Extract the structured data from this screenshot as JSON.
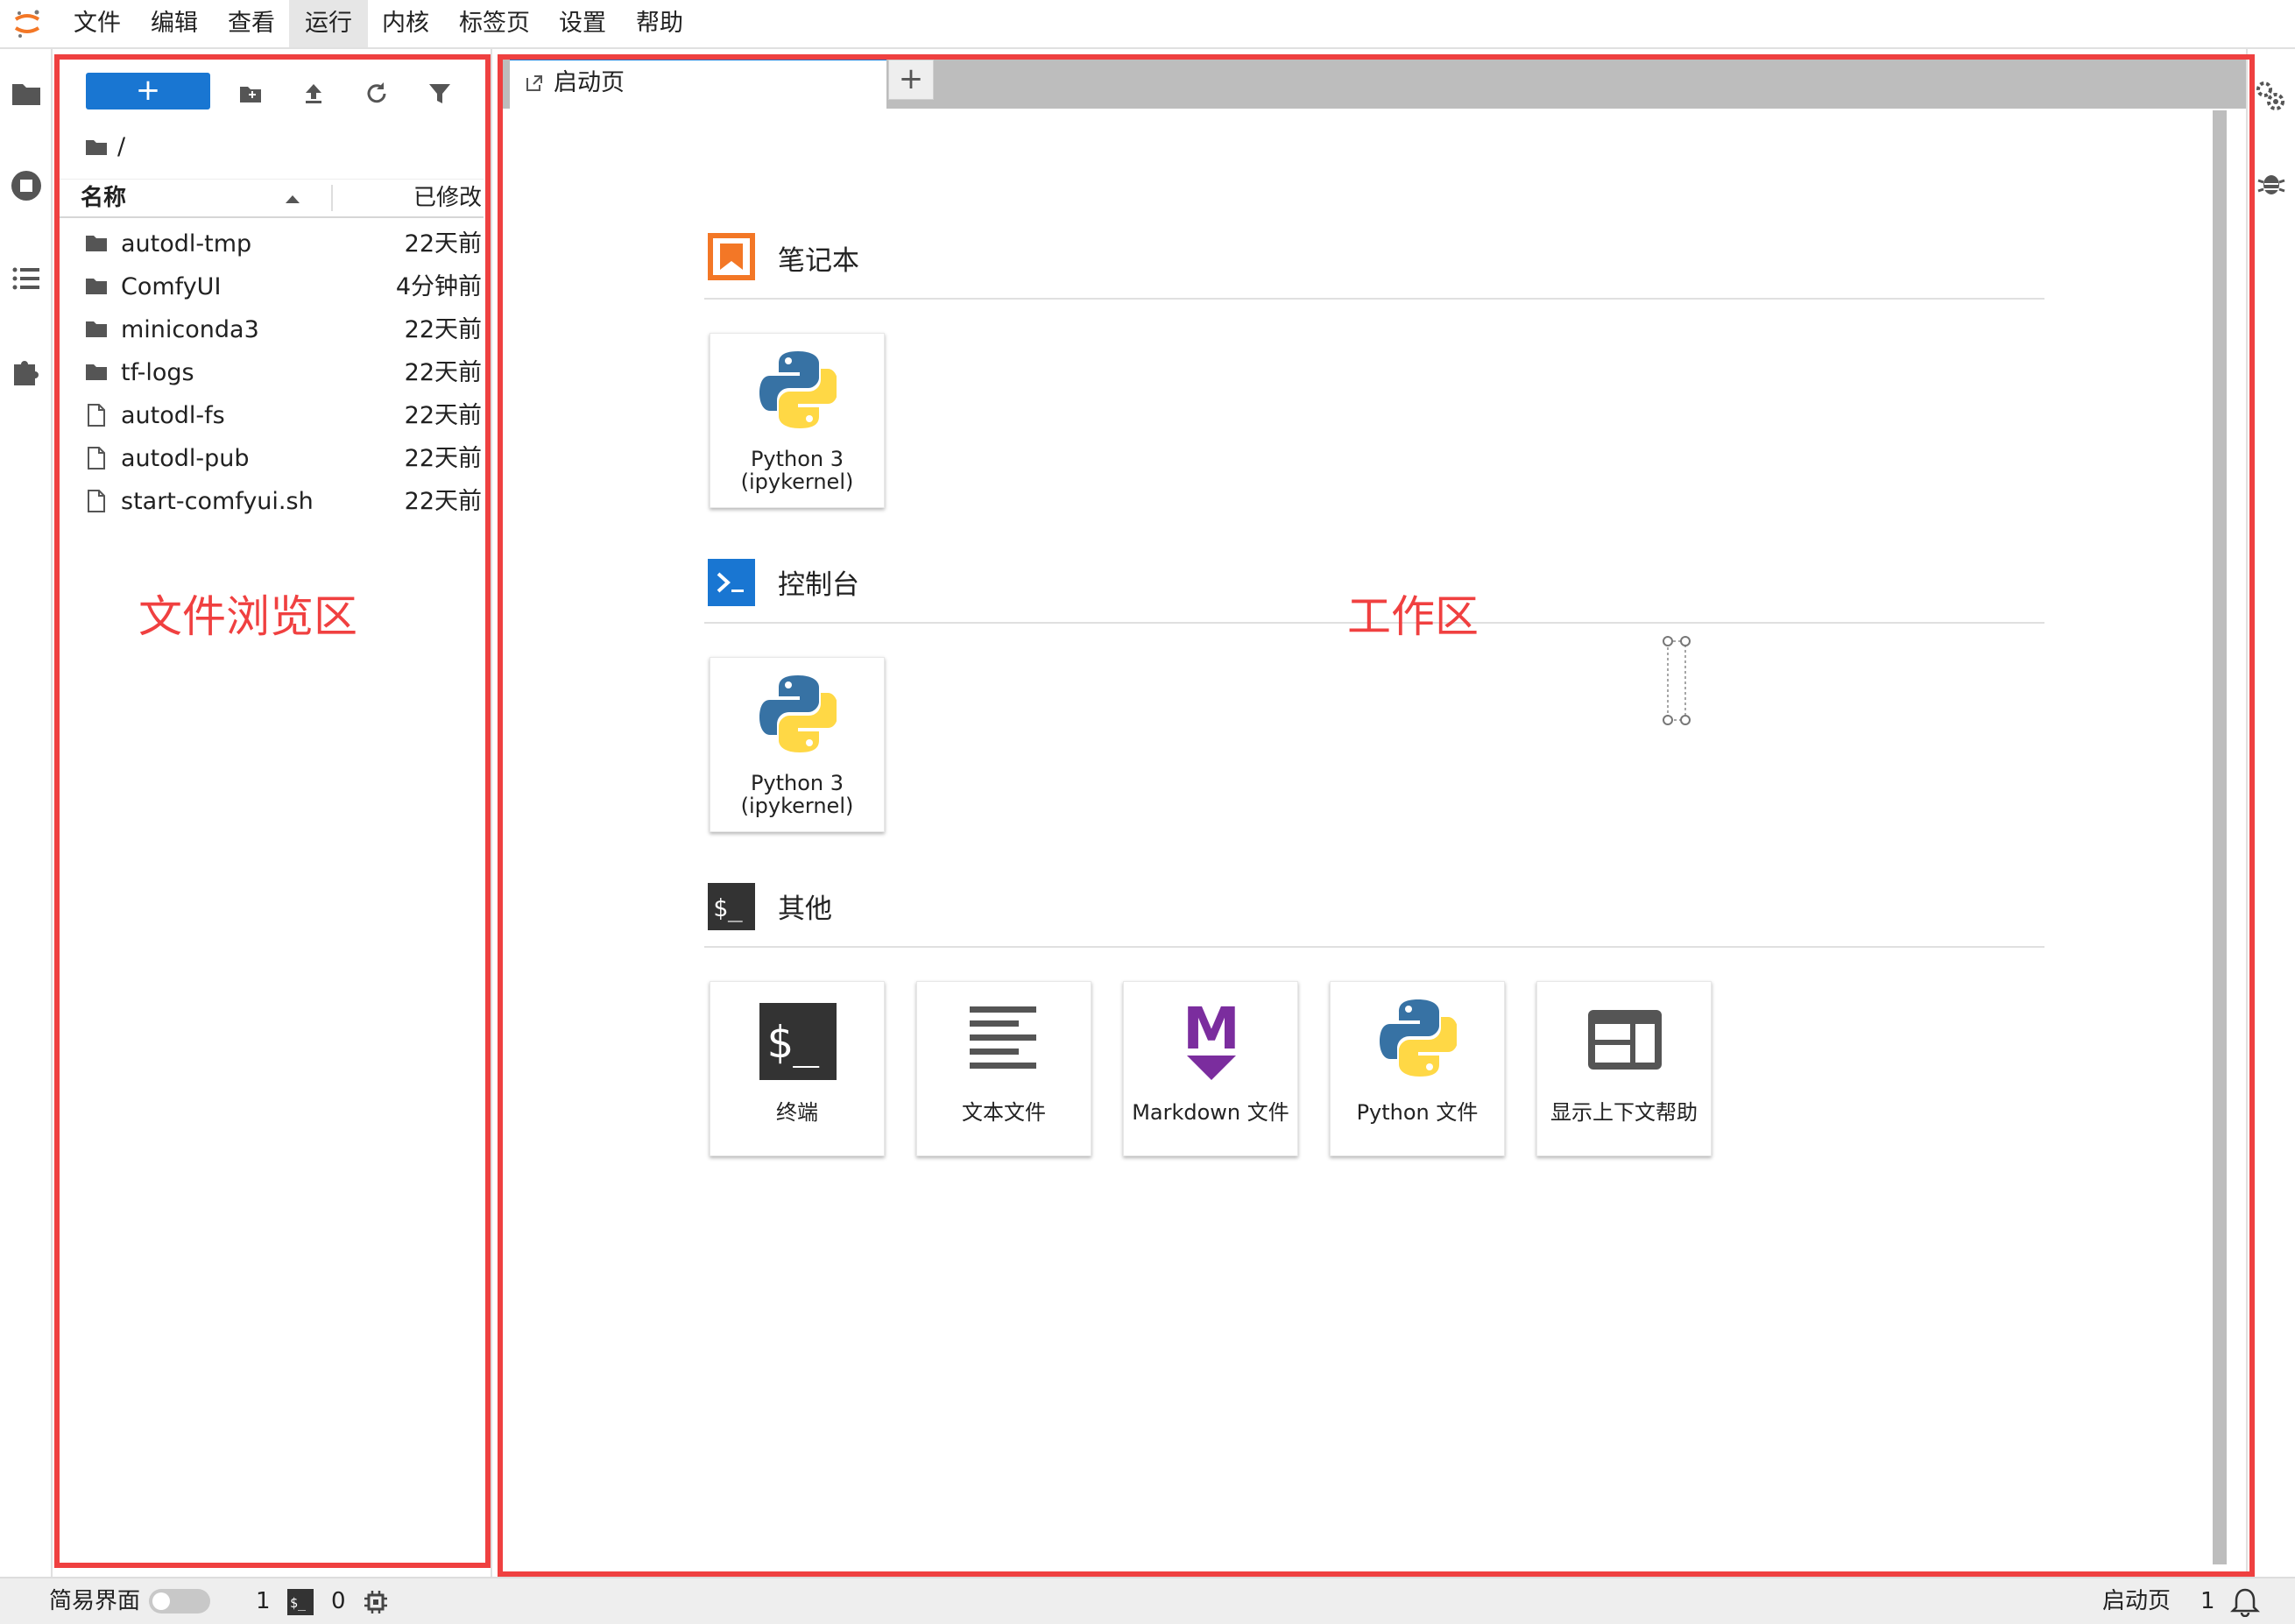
{
  "menubar": {
    "items": [
      "文件",
      "编辑",
      "查看",
      "运行",
      "内核",
      "标签页",
      "设置",
      "帮助"
    ],
    "active_index": 3
  },
  "filebrowser": {
    "new_button": "+",
    "breadcrumb": "/",
    "col_name": "名称",
    "col_modified": "已修改",
    "files": [
      {
        "name": "autodl-tmp",
        "modified": "22天前",
        "type": "folder"
      },
      {
        "name": "ComfyUI",
        "modified": "4分钟前",
        "type": "folder"
      },
      {
        "name": "miniconda3",
        "modified": "22天前",
        "type": "folder"
      },
      {
        "name": "tf-logs",
        "modified": "22天前",
        "type": "folder"
      },
      {
        "name": "autodl-fs",
        "modified": "22天前",
        "type": "file"
      },
      {
        "name": "autodl-pub",
        "modified": "22天前",
        "type": "file"
      },
      {
        "name": "start-comfyui.sh",
        "modified": "22天前",
        "type": "file"
      }
    ]
  },
  "tabs": {
    "launcher_label": "启动页",
    "add_label": "+"
  },
  "launcher": {
    "notebook": {
      "title": "笔记本",
      "cards": [
        {
          "label1": "Python 3",
          "label2": "(ipykernel)"
        }
      ]
    },
    "console": {
      "title": "控制台",
      "cards": [
        {
          "label1": "Python 3",
          "label2": "(ipykernel)"
        }
      ]
    },
    "other": {
      "title": "其他",
      "cards": [
        {
          "label": "终端",
          "icon": "terminal-icon"
        },
        {
          "label": "文本文件",
          "icon": "text-file-icon"
        },
        {
          "label": "Markdown 文件",
          "icon": "markdown-icon"
        },
        {
          "label": "Python 文件",
          "icon": "python-icon"
        },
        {
          "label": "显示上下文帮助",
          "icon": "context-help-icon"
        }
      ]
    }
  },
  "annotations": {
    "file_area": "文件浏览区",
    "work_area": "工作区",
    "color": "#ef4040"
  },
  "statusbar": {
    "simple_mode": "简易界面",
    "kernels_count": "1",
    "terminals_count": "0",
    "active_tab": "启动页",
    "notifications": "1"
  },
  "colors": {
    "accent": "#1976d2",
    "notebook_orange": "#f37726",
    "python_blue": "#3772a4",
    "python_yellow": "#ffd845",
    "markdown_purple": "#7b2d9e"
  }
}
